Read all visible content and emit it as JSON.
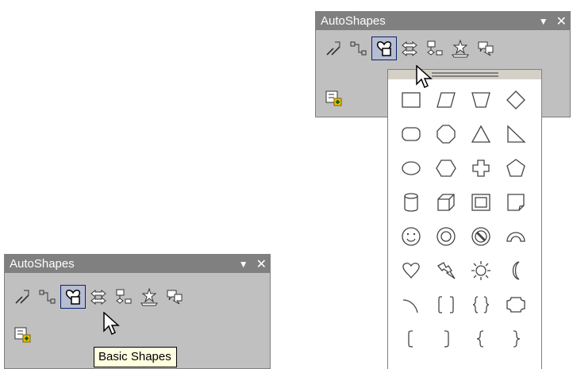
{
  "toolbar_docked": {
    "title": "AutoShapes",
    "menu_glyph": "▼",
    "close_glyph": "✕",
    "buttons": [
      {
        "name": "lines-icon"
      },
      {
        "name": "connectors-icon"
      },
      {
        "name": "basic-shapes-icon",
        "active": true
      },
      {
        "name": "block-arrows-icon"
      },
      {
        "name": "flowchart-icon"
      },
      {
        "name": "stars-banners-icon"
      },
      {
        "name": "callouts-icon"
      }
    ],
    "more_button": {
      "name": "more-autoshapes-icon"
    }
  },
  "toolbar_open": {
    "title": "AutoShapes",
    "menu_glyph": "▼",
    "close_glyph": "✕"
  },
  "tooltip": {
    "text": "Basic Shapes"
  },
  "palette": {
    "shapes": [
      "rectangle",
      "parallelogram",
      "trapezoid",
      "diamond",
      "rounded-rectangle",
      "octagon",
      "isosceles-triangle",
      "right-triangle",
      "oval",
      "hexagon",
      "cross",
      "regular-pentagon",
      "can",
      "cube",
      "bevel",
      "folded-corner",
      "smiley-face",
      "donut",
      "no-symbol",
      "block-arc",
      "heart",
      "lightning-bolt",
      "sun",
      "moon",
      "arc",
      "double-bracket",
      "double-brace",
      "plaque",
      "left-bracket",
      "right-bracket",
      "left-brace",
      "right-brace"
    ]
  },
  "colors": {
    "toolbar_bg": "#c0c0c0",
    "title_bg": "#808080",
    "active_border": "#0a246a",
    "tooltip_bg": "#ffffe1"
  }
}
